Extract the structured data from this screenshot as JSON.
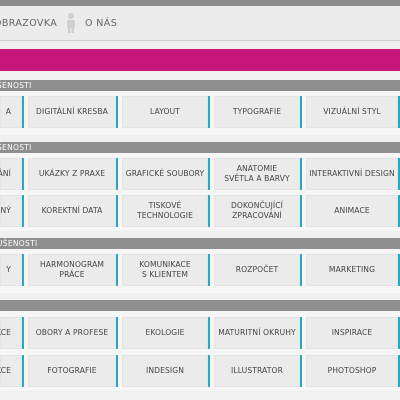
{
  "nav": {
    "items": [
      {
        "label": "OBRAZOVKA",
        "icon": "monitor-icon"
      },
      {
        "label": "O NÁS",
        "icon": "person-icon"
      }
    ]
  },
  "colors": {
    "accent_pink": "#c8177a",
    "tile_border_blue": "#2aa7c5",
    "section_gray": "#8e8e8e"
  },
  "sections": [
    {
      "title": "ŠENOSTI",
      "rows": [
        [
          "A",
          "DIGITÁLNÍ KRESBA",
          "LAYOUT",
          "TYPOGRAFIE",
          "VIZUÁLNÍ STYL"
        ]
      ]
    },
    {
      "title": "ŠENOSTI",
      "rows": [
        [
          "OVÁNÍ",
          "UKÁZKY Z PRAXE",
          "GRAFICKÉ SOUBORY",
          "ANATOMIE\nSVĚTLA A BARVY",
          "INTERAKTIVNÍ DESIGN"
        ],
        [
          "ENÝ",
          "KOREKTNÍ DATA",
          "TISKOVÉ TECHNOLOGIE",
          "DOKONČUJÍCÍ\nZPRACOVÁNÍ",
          "ANIMACE"
        ]
      ]
    },
    {
      "title": "UŠENOSTI",
      "rows": [
        [
          "Y",
          "HARMONOGRAM PRÁCE",
          "KOMUNIKACE\nS KLIENTEM",
          "ROZPOČET",
          "MARKETING"
        ]
      ]
    },
    {
      "title": "",
      "rows": [
        [
          "IKCE",
          "OBORY A PROFESE",
          "EKOLOGIE",
          "MATURITNÍ OKRUHY",
          "INSPIRACE"
        ],
        [
          "IKCE",
          "FOTOGRAFIE",
          "INDESIGN",
          "ILLUSTRATOR",
          "PHOTOSHOP"
        ]
      ]
    }
  ]
}
